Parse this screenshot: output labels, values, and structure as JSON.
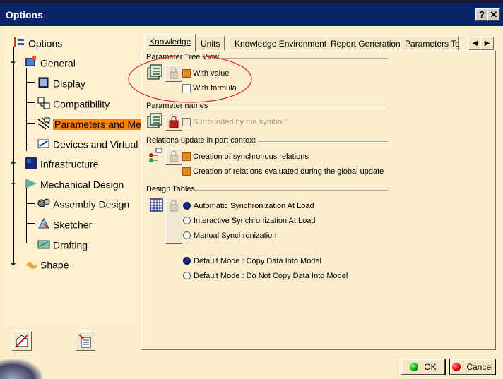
{
  "window": {
    "title": "Options"
  },
  "titlebar": {
    "help_label": "?",
    "close_label": "✕"
  },
  "tree": {
    "items": [
      {
        "label": "Options"
      },
      {
        "label": "General"
      },
      {
        "label": "Display"
      },
      {
        "label": "Compatibility"
      },
      {
        "label": "Parameters and Mea"
      },
      {
        "label": "Devices and Virtual I"
      },
      {
        "label": "Infrastructure"
      },
      {
        "label": "Mechanical Design"
      },
      {
        "label": "Assembly Design"
      },
      {
        "label": "Sketcher"
      },
      {
        "label": "Drafting"
      },
      {
        "label": "Shape"
      }
    ],
    "selected": "Parameters and Mea"
  },
  "tabs": [
    {
      "label": "Knowledge",
      "active": true
    },
    {
      "label": "Units"
    },
    {
      "label": "Knowledge Environment"
    },
    {
      "label": "Report Generation"
    },
    {
      "label": "Parameters Toler"
    }
  ],
  "tab_scroll": {
    "left": "◀",
    "right": "▶"
  },
  "sections": {
    "parameter_tree_view": {
      "title": "Parameter Tree View",
      "with_value": {
        "label": "With value",
        "checked": true
      },
      "with_formula": {
        "label": "With formula",
        "checked": false
      }
    },
    "parameter_names": {
      "title": "Parameter names",
      "surrounded": {
        "label": "Surrounded by the symbol '",
        "checked": false,
        "enabled": false
      }
    },
    "relations_update": {
      "title": "Relations update in part context",
      "sync_relations": {
        "label": "Creation of synchronous relations",
        "checked": true
      },
      "global_update": {
        "label": "Creation of relations evaluated during the global update",
        "checked": true
      }
    },
    "design_tables": {
      "title": "Design Tables",
      "auto_sync": {
        "label": "Automatic Synchronization At Load",
        "selected": true
      },
      "interactive_sync": {
        "label": "Interactive Synchronization At Load",
        "selected": false
      },
      "manual_sync": {
        "label": "Manual Synchronization",
        "selected": false
      },
      "default_copy": {
        "label": "Default Mode : Copy Data Into Model",
        "selected": true
      },
      "default_nocopy": {
        "label": "Default Mode : Do Not Copy Data Into Model",
        "selected": false
      }
    }
  },
  "buttons": {
    "ok": "OK",
    "cancel": "Cancel"
  },
  "colors": {
    "selection": "#ff7f00",
    "titlebar": "#0a246a",
    "background": "#f9edce",
    "annotation": "#e02020"
  }
}
